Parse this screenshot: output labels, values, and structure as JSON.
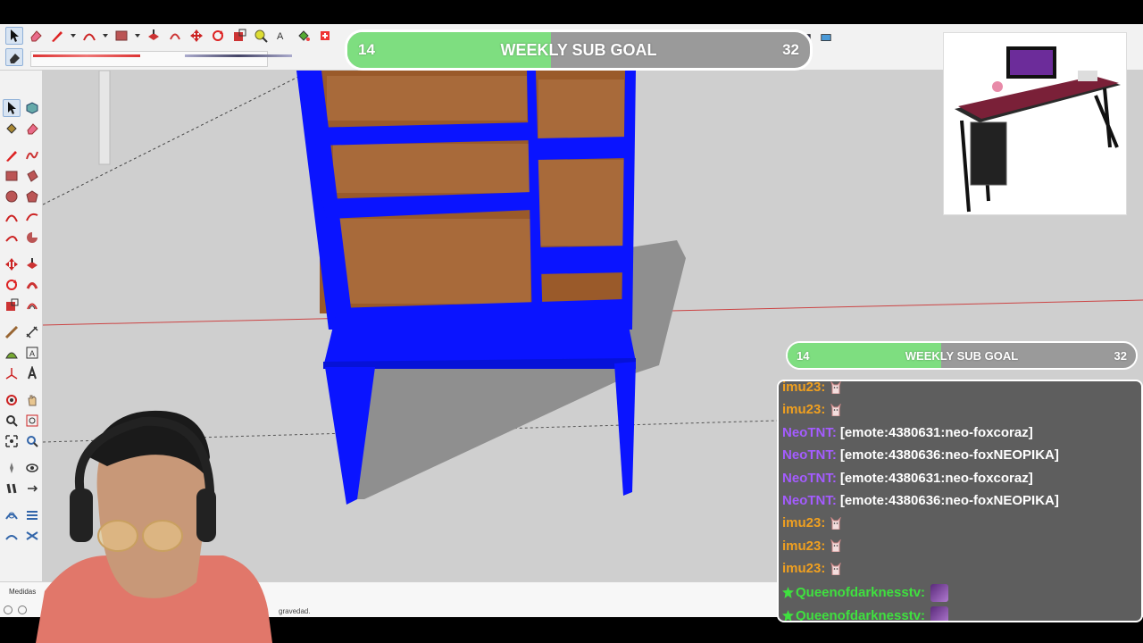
{
  "statusbar": {
    "measure_label": "Medidas",
    "hint_text": "gravedad."
  },
  "sub_goal_top": {
    "current": "14",
    "title": "WEEKLY SUB GOAL",
    "target": "32",
    "progress_fraction": 0.44
  },
  "sub_goal_chat": {
    "current": "14",
    "title": "WEEKLY SUB GOAL",
    "target": "32",
    "progress_fraction": 0.44
  },
  "chat": {
    "messages": [
      {
        "user": "imu23:",
        "text": "",
        "color": "#f0a020",
        "emote": "cat"
      },
      {
        "user": "imu23:",
        "text": "",
        "color": "#f0a020",
        "emote": "cat"
      },
      {
        "user": "NeoTNT:",
        "text": "[emote:4380631:neo-foxcoraz]",
        "color": "#a45cff",
        "emote": ""
      },
      {
        "user": "NeoTNT:",
        "text": "[emote:4380636:neo-foxNEOPIKA]",
        "color": "#a45cff",
        "emote": ""
      },
      {
        "user": "NeoTNT:",
        "text": "[emote:4380631:neo-foxcoraz]",
        "color": "#a45cff",
        "emote": ""
      },
      {
        "user": "NeoTNT:",
        "text": "[emote:4380636:neo-foxNEOPIKA]",
        "color": "#a45cff",
        "emote": ""
      },
      {
        "user": "imu23:",
        "text": "",
        "color": "#f0a020",
        "emote": "cat"
      },
      {
        "user": "imu23:",
        "text": "",
        "color": "#f0a020",
        "emote": "cat"
      },
      {
        "user": "imu23:",
        "text": "",
        "color": "#f0a020",
        "emote": "cat"
      },
      {
        "user": "Queenofdarknesstv:",
        "text": "",
        "color": "#3fe03f",
        "emote": "queen"
      },
      {
        "user": "Queenofdarknesstv:",
        "text": "",
        "color": "#3fe03f",
        "emote": "queen"
      }
    ]
  },
  "colors": {
    "model_blue": "#0a14ff",
    "wood": "#9a5a2a",
    "goal_fill": "#7ede80",
    "goal_track": "#9a9a9a",
    "chat_bg": "#5e5e5e",
    "viewport_bg": "#cfcfcf"
  }
}
